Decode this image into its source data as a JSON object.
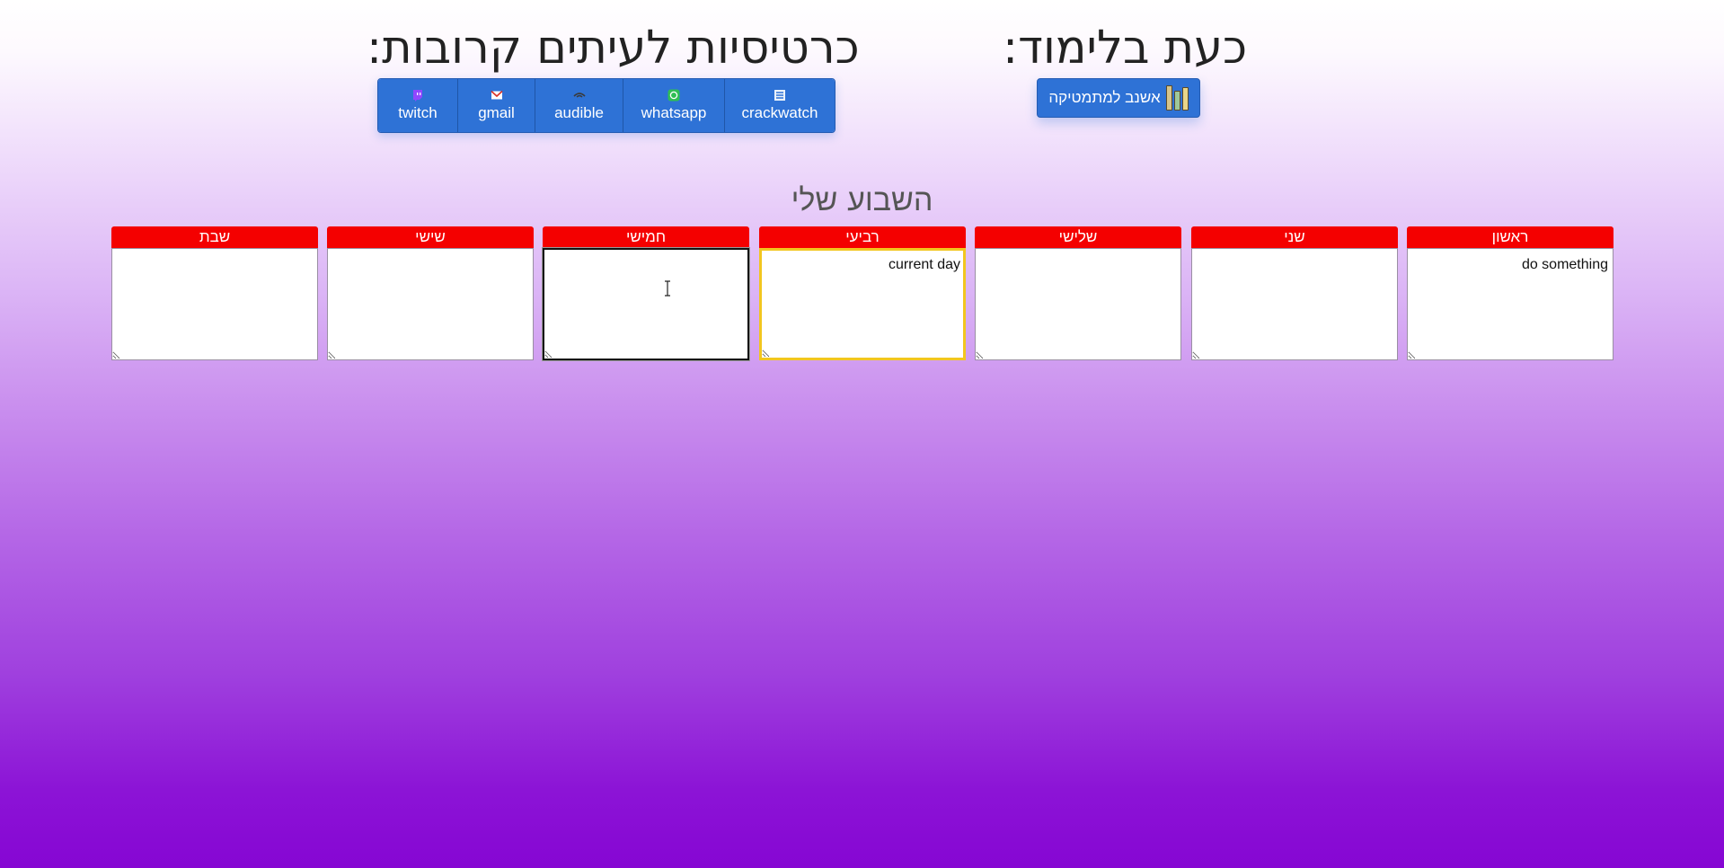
{
  "headings": {
    "now_studying": "כעת בלימוד:",
    "shortcuts": "כרטיסיות לעיתים קרובות:"
  },
  "study_button": {
    "label": "אשנב למתמטיקה",
    "icon": "books-icon"
  },
  "shortcuts": [
    {
      "label": "crackwatch",
      "icon": "crackwatch-icon"
    },
    {
      "label": "whatsapp",
      "icon": "whatsapp-icon"
    },
    {
      "label": "audible",
      "icon": "audible-icon"
    },
    {
      "label": "gmail",
      "icon": "gmail-icon"
    },
    {
      "label": "twitch",
      "icon": "twitch-icon"
    }
  ],
  "week": {
    "title": "השבוע שלי",
    "days": [
      {
        "name": "ראשון",
        "text": "do something"
      },
      {
        "name": "שני",
        "text": ""
      },
      {
        "name": "שלישי",
        "text": ""
      },
      {
        "name": "רביעי",
        "text": "current day"
      },
      {
        "name": "חמישי",
        "text": ""
      },
      {
        "name": "שישי",
        "text": ""
      },
      {
        "name": "שבת",
        "text": ""
      }
    ]
  },
  "colors": {
    "button_blue": "#2e72d6",
    "day_header_red": "#f40000",
    "current_day_border": "#f2c61f",
    "background_bottom": "#8606d3"
  }
}
